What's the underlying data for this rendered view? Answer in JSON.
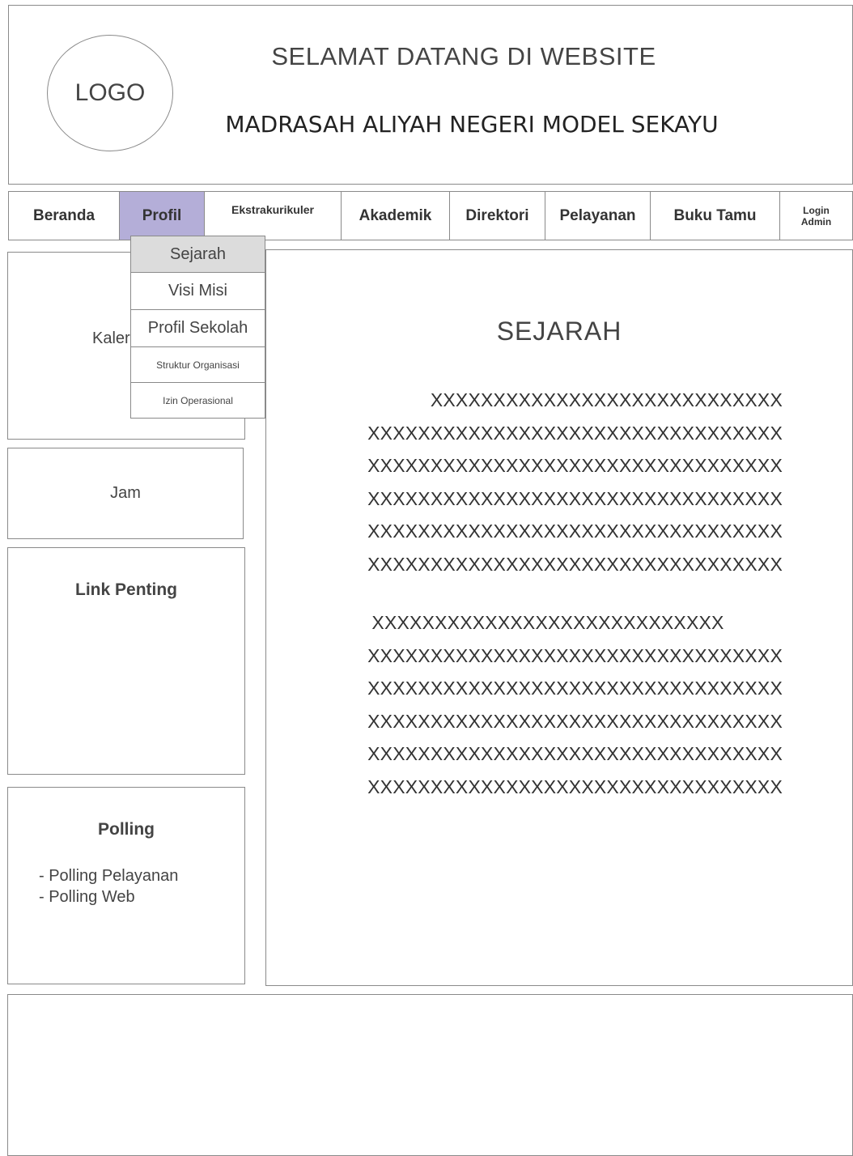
{
  "header": {
    "logo": "LOGO",
    "welcome": "SELAMAT DATANG DI WEBSITE",
    "school": "MADRASAH ALIYAH NEGERI MODEL SEKAYU"
  },
  "nav": {
    "items": [
      {
        "label": "Beranda"
      },
      {
        "label": "Profil"
      },
      {
        "label": "Ekstrakurikuler"
      },
      {
        "label": "Akademik"
      },
      {
        "label": "Direktori"
      },
      {
        "label": "Pelayanan"
      },
      {
        "label": "Buku Tamu"
      },
      {
        "label": "Login Admin"
      }
    ],
    "active": "Profil",
    "active_color": "#b4aed8"
  },
  "dropdown": {
    "items": [
      {
        "label": "Sejarah"
      },
      {
        "label": "Visi Misi"
      },
      {
        "label": "Profil Sekolah"
      },
      {
        "label": "Struktur Organisasi"
      },
      {
        "label": "Izin Operasional"
      }
    ],
    "selected": "Sejarah"
  },
  "sidebar": {
    "kalender_visible": "Kaler",
    "jam": "Jam",
    "links_title": "Link Penting",
    "polling_title": "Polling",
    "polling_items": [
      "- Polling Pelayanan",
      "- Polling Web"
    ]
  },
  "main": {
    "title": "SEJARAH",
    "para1": [
      "XXXXXXXXXXXXXXXXXXXXXXXXXXXX",
      "XXXXXXXXXXXXXXXXXXXXXXXXXXXXXXXXX",
      "XXXXXXXXXXXXXXXXXXXXXXXXXXXXXXXXX",
      "XXXXXXXXXXXXXXXXXXXXXXXXXXXXXXXXX",
      "XXXXXXXXXXXXXXXXXXXXXXXXXXXXXXXXX",
      "XXXXXXXXXXXXXXXXXXXXXXXXXXXXXXXXX"
    ],
    "para2": [
      "XXXXXXXXXXXXXXXXXXXXXXXXXXXX",
      "XXXXXXXXXXXXXXXXXXXXXXXXXXXXXXXXX",
      "XXXXXXXXXXXXXXXXXXXXXXXXXXXXXXXXX",
      "XXXXXXXXXXXXXXXXXXXXXXXXXXXXXXXXX",
      "XXXXXXXXXXXXXXXXXXXXXXXXXXXXXXXXX",
      "XXXXXXXXXXXXXXXXXXXXXXXXXXXXXXXXX"
    ]
  }
}
